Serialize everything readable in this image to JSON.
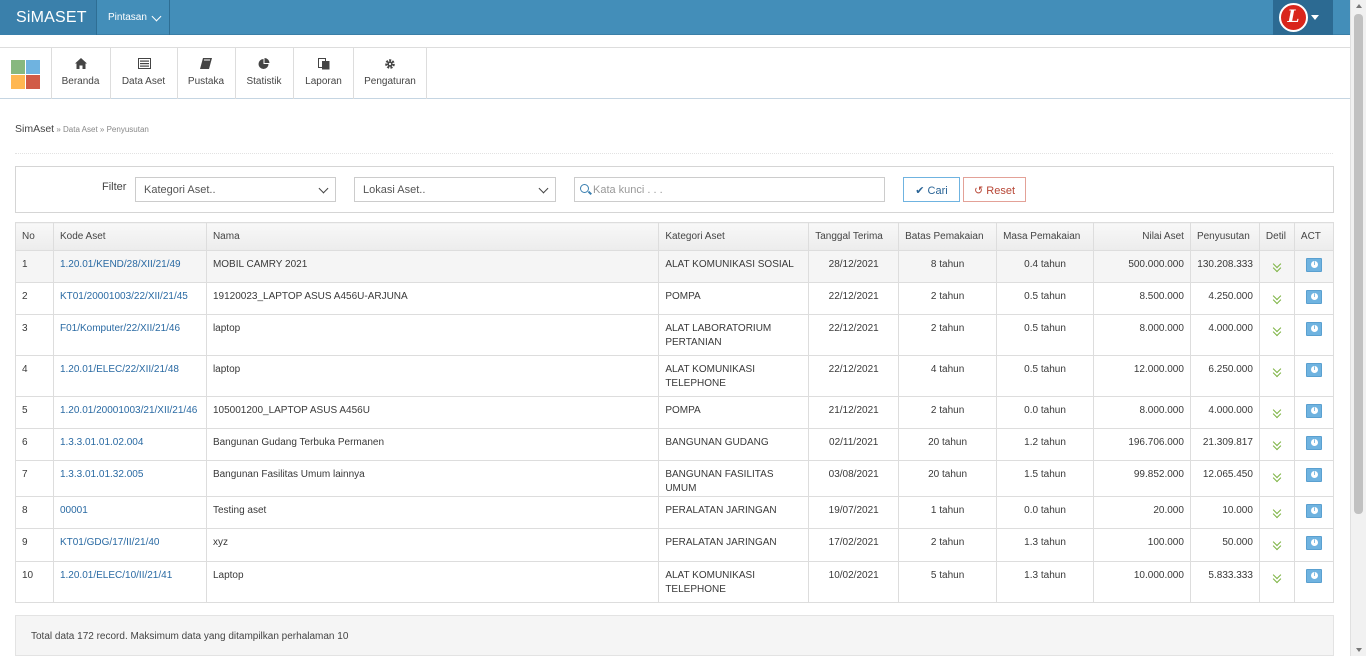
{
  "app": {
    "title": "SiMASET",
    "shortcut_label": "Pintasan",
    "user_avatar_letter": "L"
  },
  "menu": [
    {
      "label": "Beranda",
      "icon": "home-icon"
    },
    {
      "label": "Data Aset",
      "icon": "list-icon"
    },
    {
      "label": "Pustaka",
      "icon": "book-icon"
    },
    {
      "label": "Statistik",
      "icon": "pie-chart-icon"
    },
    {
      "label": "Laporan",
      "icon": "copy-icon"
    },
    {
      "label": "Pengaturan",
      "icon": "gear-icon"
    }
  ],
  "breadcrumb": {
    "root": "SimAset",
    "sep1": " » ",
    "item1": "Data Aset",
    "sep2": " » ",
    "item2": "Penyusutan"
  },
  "filter": {
    "label": "Filter",
    "category_value": "Kategori Aset..",
    "location_value": "Lokasi Aset..",
    "search_placeholder": "Kata kunci . . .",
    "search_button": "Cari",
    "reset_button": "Reset"
  },
  "table": {
    "headers": [
      "No",
      "Kode Aset",
      "Nama",
      "Kategori Aset",
      "Tanggal Terima",
      "Batas Pemakaian",
      "Masa Pemakaian",
      "Nilai Aset",
      "Penyusutan",
      "Detil",
      "ACT"
    ],
    "rows": [
      [
        "1",
        "1.20.01/KEND/28/XII/21/49",
        "MOBIL CAMRY 2021",
        "ALAT KOMUNIKASI SOSIAL",
        "28/12/2021",
        "8 tahun",
        "0.4 tahun",
        "500.000.000",
        "130.208.333"
      ],
      [
        "2",
        "KT01/20001003/22/XII/21/45",
        "19120023_LAPTOP ASUS A456U-ARJUNA",
        "POMPA",
        "22/12/2021",
        "2 tahun",
        "0.5 tahun",
        "8.500.000",
        "4.250.000"
      ],
      [
        "3",
        "F01/Komputer/22/XII/21/46",
        "laptop",
        "ALAT LABORATORIUM PERTANIAN",
        "22/12/2021",
        "2 tahun",
        "0.5 tahun",
        "8.000.000",
        "4.000.000"
      ],
      [
        "4",
        "1.20.01/ELEC/22/XII/21/48",
        "laptop",
        "ALAT KOMUNIKASI TELEPHONE",
        "22/12/2021",
        "4 tahun",
        "0.5 tahun",
        "12.000.000",
        "6.250.000"
      ],
      [
        "5",
        "1.20.01/20001003/21/XII/21/46",
        "105001200_LAPTOP ASUS A456U",
        "POMPA",
        "21/12/2021",
        "2 tahun",
        "0.0 tahun",
        "8.000.000",
        "4.000.000"
      ],
      [
        "6",
        "1.3.3.01.01.02.004",
        "Bangunan Gudang Terbuka Permanen",
        "BANGUNAN GUDANG",
        "02/11/2021",
        "20 tahun",
        "1.2 tahun",
        "196.706.000",
        "21.309.817"
      ],
      [
        "7",
        "1.3.3.01.01.32.005",
        "Bangunan Fasilitas Umum lainnya",
        "BANGUNAN FASILITAS UMUM",
        "03/08/2021",
        "20 tahun",
        "1.5 tahun",
        "99.852.000",
        "12.065.450"
      ],
      [
        "8",
        "00001",
        "Testing aset",
        "PERALATAN JARINGAN",
        "19/07/2021",
        "1 tahun",
        "0.0 tahun",
        "20.000",
        "10.000"
      ],
      [
        "9",
        "KT01/GDG/17/II/21/40",
        "xyz",
        "PERALATAN JARINGAN",
        "17/02/2021",
        "2 tahun",
        "1.3 tahun",
        "100.000",
        "50.000"
      ],
      [
        "10",
        "1.20.01/ELEC/10/II/21/41",
        "Laptop",
        "ALAT KOMUNIKASI TELEPHONE",
        "10/02/2021",
        "5 tahun",
        "1.3 tahun",
        "10.000.000",
        "5.833.333"
      ]
    ]
  },
  "footer": {
    "text": "Total data 172 record. Maksimum data yang ditampilkan perhalaman 10"
  },
  "colors": {
    "topbar": "#438eb9",
    "link": "#2a6aa3",
    "detail_chevron": "#7cb342",
    "info_button": "#6fb3e0"
  }
}
